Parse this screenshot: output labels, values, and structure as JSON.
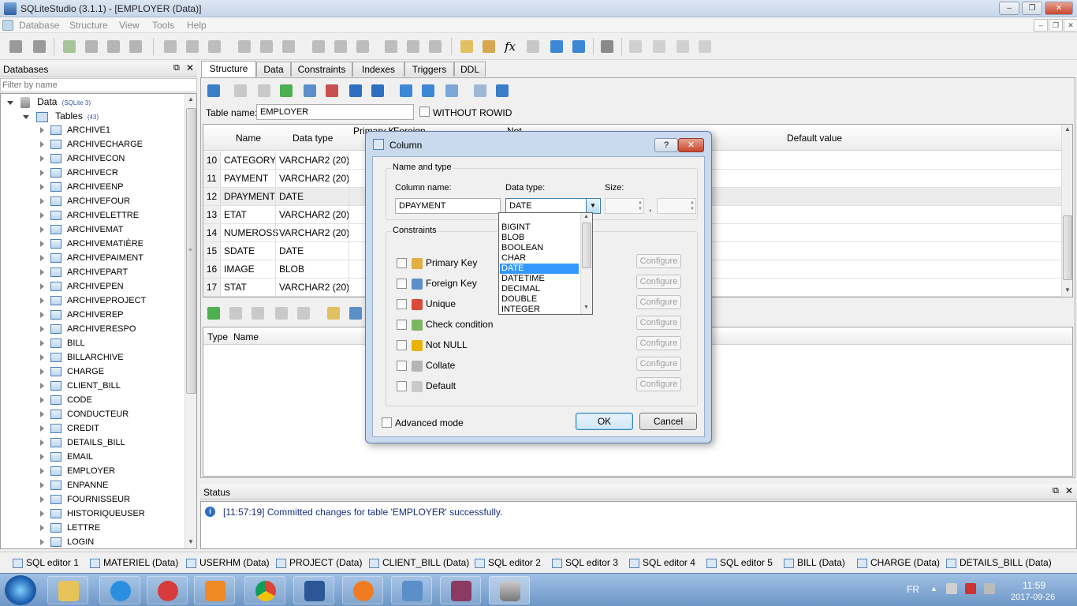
{
  "window": {
    "title": "SQLiteStudio (3.1.1) - [EMPLOYER (Data)]"
  },
  "menu": [
    "Database",
    "Structure",
    "View",
    "Tools",
    "Help"
  ],
  "databases_panel": {
    "title": "Databases",
    "filter_placeholder": "Filter by name",
    "db_name": "Data",
    "db_version": "(SQLite 3)",
    "tables_label": "Tables",
    "tables_count": "(43)",
    "tables": [
      "ARCHIVE1",
      "ARCHIVECHARGE",
      "ARCHIVECON",
      "ARCHIVECR",
      "ARCHIVEENP",
      "ARCHIVEFOUR",
      "ARCHIVELETTRE",
      "ARCHIVEMAT",
      "ARCHIVEMATIÈRE",
      "ARCHIVEPAIMENT",
      "ARCHIVEPART",
      "ARCHIVEPEN",
      "ARCHIVEPROJECT",
      "ARCHIVEREP",
      "ARCHIVERESPO",
      "BILL",
      "BILLARCHIVE",
      "CHARGE",
      "CLIENT_BILL",
      "CODE",
      "CONDUCTEUR",
      "CREDIT",
      "DETAILS_BILL",
      "EMAIL",
      "EMPLOYER",
      "ENPANNE",
      "FOURNISSEUR",
      "HISTORIQUEUSER",
      "LETTRE",
      "LOGIN"
    ]
  },
  "tabs": [
    "Structure",
    "Data",
    "Constraints",
    "Indexes",
    "Triggers",
    "DDL"
  ],
  "table_editor": {
    "table_name_label": "Table name:",
    "table_name": "EMPLOYER",
    "without_rowid": "WITHOUT ROWID",
    "columns_header": {
      "name": "Name",
      "type": "Data type",
      "pk": "Primary K",
      "fk": "Foreign",
      "nn": "Not",
      "default": "Default value"
    },
    "rows": [
      {
        "n": "10",
        "name": "CATEGORY",
        "type": "VARCHAR2 (20)"
      },
      {
        "n": "11",
        "name": "PAYMENT",
        "type": "VARCHAR2 (20)"
      },
      {
        "n": "12",
        "name": "DPAYMENT",
        "type": "DATE"
      },
      {
        "n": "13",
        "name": "ETAT",
        "type": "VARCHAR2 (20)"
      },
      {
        "n": "14",
        "name": "NUMEROSS",
        "type": "VARCHAR2 (20)"
      },
      {
        "n": "15",
        "name": "SDATE",
        "type": "DATE"
      },
      {
        "n": "16",
        "name": "IMAGE",
        "type": "BLOB"
      },
      {
        "n": "17",
        "name": "STAT",
        "type": "VARCHAR2 (20)"
      }
    ],
    "constraints_header": {
      "type": "Type",
      "name": "Name"
    }
  },
  "dialog": {
    "title": "Column",
    "help": "?",
    "name_type_group": "Name and type",
    "column_name_label": "Column name:",
    "column_name": "DPAYMENT",
    "data_type_label": "Data type:",
    "data_type": "DATE",
    "size_label": "Size:",
    "size_sep": ",",
    "constraints_group": "Constraints",
    "constraints": [
      "Primary Key",
      "Foreign Key",
      "Unique",
      "Check condition",
      "Not NULL",
      "Collate",
      "Default"
    ],
    "configure_label": "Configure",
    "advanced_mode": "Advanced mode",
    "ok": "OK",
    "cancel": "Cancel",
    "type_options": [
      "BIGINT",
      "BLOB",
      "BOOLEAN",
      "CHAR",
      "DATE",
      "DATETIME",
      "DECIMAL",
      "DOUBLE",
      "INTEGER"
    ],
    "selected_option": "DATE"
  },
  "status": {
    "title": "Status",
    "message": "[11:57:19]  Committed changes for table 'EMPLOYER' successfully."
  },
  "window_tasks": [
    "SQL editor 1",
    "MATERIEL (Data)",
    "USERHM (Data)",
    "PROJECT (Data)",
    "CLIENT_BILL (Data)",
    "SQL editor 2",
    "SQL editor 3",
    "SQL editor 4",
    "SQL editor 5",
    "BILL (Data)",
    "CHARGE (Data)",
    "DETAILS_BILL (Data)"
  ],
  "taskbar": {
    "lang": "FR",
    "time": "11:59",
    "date": "2017-09-26"
  }
}
